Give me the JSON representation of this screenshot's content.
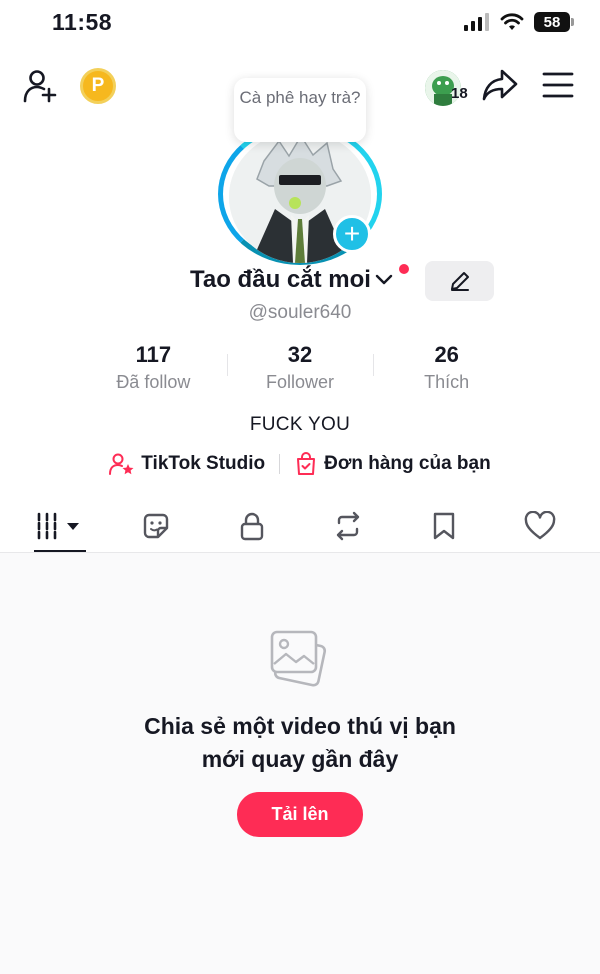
{
  "status_bar": {
    "time": "11:58",
    "battery": "58"
  },
  "top_bar": {
    "coin_label": "P",
    "inbox_badge": "18"
  },
  "profile": {
    "note_bubble": "Cà phê hay trà?",
    "display_name": "Tao đầu cắt moi",
    "username": "@souler640",
    "bio": "FUCK YOU"
  },
  "stats": [
    {
      "value": "117",
      "label": "Đã follow"
    },
    {
      "value": "32",
      "label": "Follower"
    },
    {
      "value": "26",
      "label": "Thích"
    }
  ],
  "links": {
    "studio": "TikTok Studio",
    "orders": "Đơn hàng của bạn"
  },
  "tabs": [
    "videos-grid",
    "stickers",
    "private",
    "reposts",
    "favorites",
    "liked"
  ],
  "empty_state": {
    "title": "Chia sẻ một video thú vị bạn mới quay gần đây",
    "button": "Tải lên"
  },
  "colors": {
    "accent": "#fe2c55",
    "ring": "#22d3ee",
    "coin": "#f6b81e"
  }
}
